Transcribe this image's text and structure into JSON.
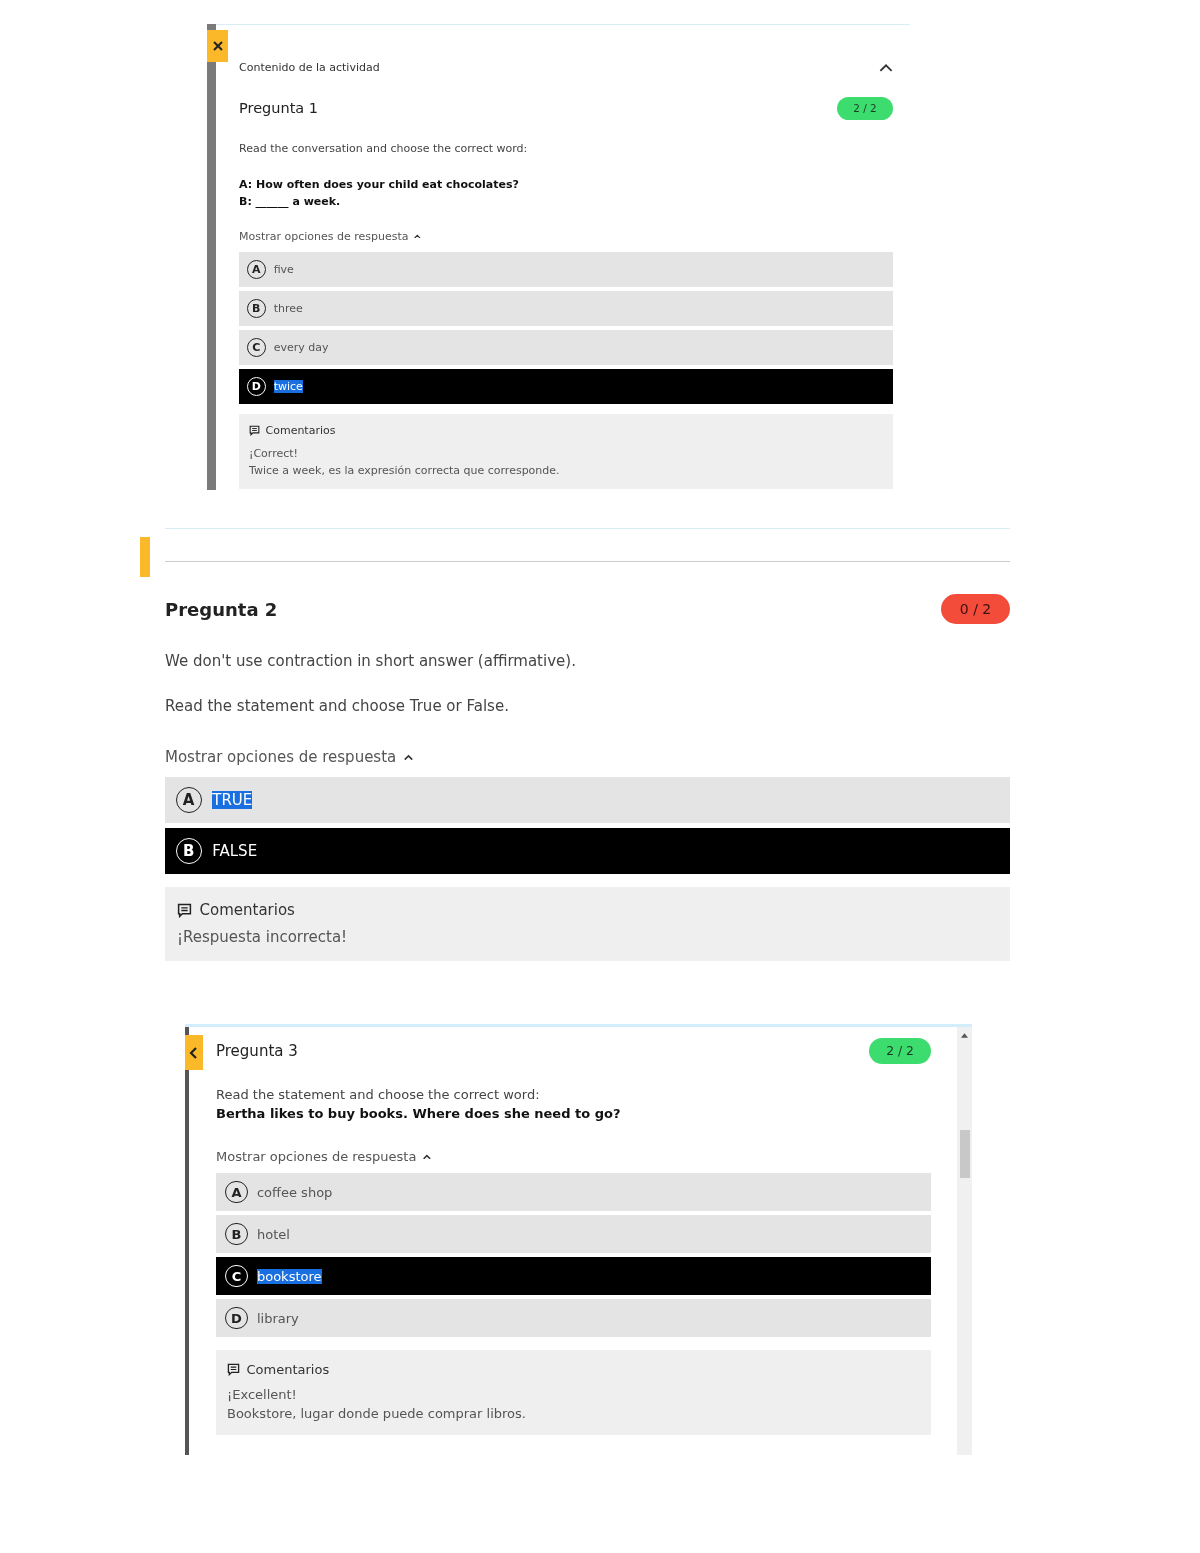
{
  "panels": [
    {
      "kind": "close",
      "activity_header": {
        "title": "Contenido de la actividad",
        "expanded": true
      },
      "question": {
        "title": "Pregunta 1",
        "score": "2 / 2",
        "correct": true
      },
      "paragraphs": [
        [
          {
            "text": "Read the conversation and choose the correct word:",
            "bold": false
          }
        ],
        [
          {
            "text": "A: How often does your child eat chocolates?",
            "bold": true
          },
          {
            "text": "B: ______ a week.",
            "bold": true
          }
        ]
      ],
      "options_toggle": {
        "label": "Mostrar opciones de respuesta",
        "expanded": true
      },
      "options": [
        {
          "letter": "A",
          "text": "five",
          "selected": false,
          "highlighted": false
        },
        {
          "letter": "B",
          "text": "three",
          "selected": false,
          "highlighted": false
        },
        {
          "letter": "C",
          "text": "every day",
          "selected": false,
          "highlighted": false
        },
        {
          "letter": "D",
          "text": "twice",
          "selected": true,
          "highlighted": true
        }
      ],
      "feedback": {
        "title": "Comentarios",
        "lines": [
          "¡Correct!",
          "Twice a week, es la expresión correcta que corresponde."
        ]
      }
    },
    {
      "kind": "marker",
      "question": {
        "title": "Pregunta 2",
        "score": "0 / 2",
        "correct": false
      },
      "paragraphs": [
        [
          {
            "text": "We don't use contraction in short answer (affirmative).",
            "bold": false
          }
        ],
        [
          {
            "text": "Read the statement and choose True or False.",
            "bold": false
          }
        ]
      ],
      "options_toggle": {
        "label": "Mostrar opciones de respuesta",
        "expanded": true
      },
      "options": [
        {
          "letter": "A",
          "text": "TRUE",
          "selected": false,
          "highlighted": true
        },
        {
          "letter": "B",
          "text": "FALSE",
          "selected": true,
          "highlighted": false
        }
      ],
      "feedback": {
        "title": "Comentarios",
        "lines": [
          "¡Respuesta incorrecta!"
        ]
      }
    },
    {
      "kind": "back",
      "question": {
        "title": "Pregunta 3",
        "score": "2 / 2",
        "correct": true
      },
      "paragraphs": [
        [
          {
            "text": "Read the statement and choose the correct word:",
            "bold": false
          },
          {
            "text": "Bertha likes to buy books. Where does she need to go?",
            "bold": true
          }
        ]
      ],
      "options_toggle": {
        "label": "Mostrar opciones de respuesta",
        "expanded": true
      },
      "options": [
        {
          "letter": "A",
          "text": "coffee shop",
          "selected": false,
          "highlighted": false
        },
        {
          "letter": "B",
          "text": "hotel",
          "selected": false,
          "highlighted": false
        },
        {
          "letter": "C",
          "text": "bookstore",
          "selected": true,
          "highlighted": true
        },
        {
          "letter": "D",
          "text": "library",
          "selected": false,
          "highlighted": false
        }
      ],
      "feedback": {
        "title": "Comentarios",
        "lines": [
          "¡Excellent!",
          "Bookstore, lugar donde puede comprar libros."
        ]
      }
    }
  ]
}
